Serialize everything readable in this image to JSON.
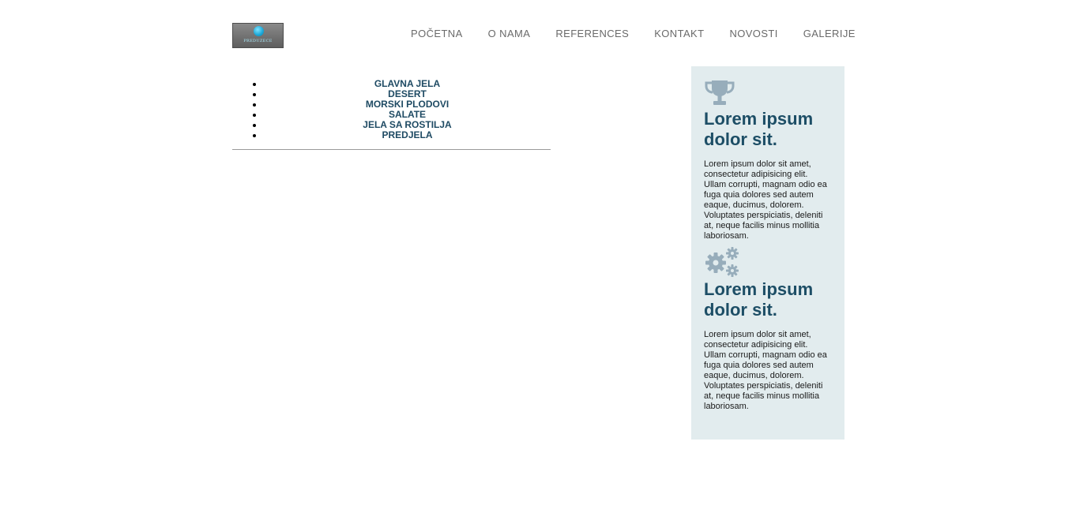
{
  "header": {
    "logo_text": "PREDUZECE",
    "nav": [
      {
        "label": "POČETNA"
      },
      {
        "label": "O NAMA"
      },
      {
        "label": "REFERENCES"
      },
      {
        "label": "KONTAKT"
      },
      {
        "label": "NOVOSTI"
      },
      {
        "label": "GALERIJE"
      }
    ]
  },
  "menu": {
    "items": [
      {
        "label": "GLAVNA JELA"
      },
      {
        "label": "DESERT"
      },
      {
        "label": "MORSKI PLODOVI"
      },
      {
        "label": "SALATE"
      },
      {
        "label": "JELA SA ROSTILJA"
      },
      {
        "label": "PREDJELA"
      }
    ]
  },
  "sidebar": {
    "background_color": "#e2ecee",
    "heading_color": "#1d4e66",
    "features": [
      {
        "icon": "trophy-icon",
        "heading": "Lorem ipsum dolor sit.",
        "text": "Lorem ipsum dolor sit amet, consectetur adipisicing elit. Ullam corrupti, magnam odio ea fuga quia dolores sed autem eaque, ducimus, dolorem. Voluptates perspiciatis, deleniti at, neque facilis minus mollitia laboriosam."
      },
      {
        "icon": "gears-icon",
        "heading": "Lorem ipsum dolor sit.",
        "text": "Lorem ipsum dolor sit amet, consectetur adipisicing elit. Ullam corrupti, magnam odio ea fuga quia dolores sed autem eaque, ducimus, dolorem. Voluptates perspiciatis, deleniti at, neque facilis minus mollitia laboriosam."
      }
    ]
  }
}
